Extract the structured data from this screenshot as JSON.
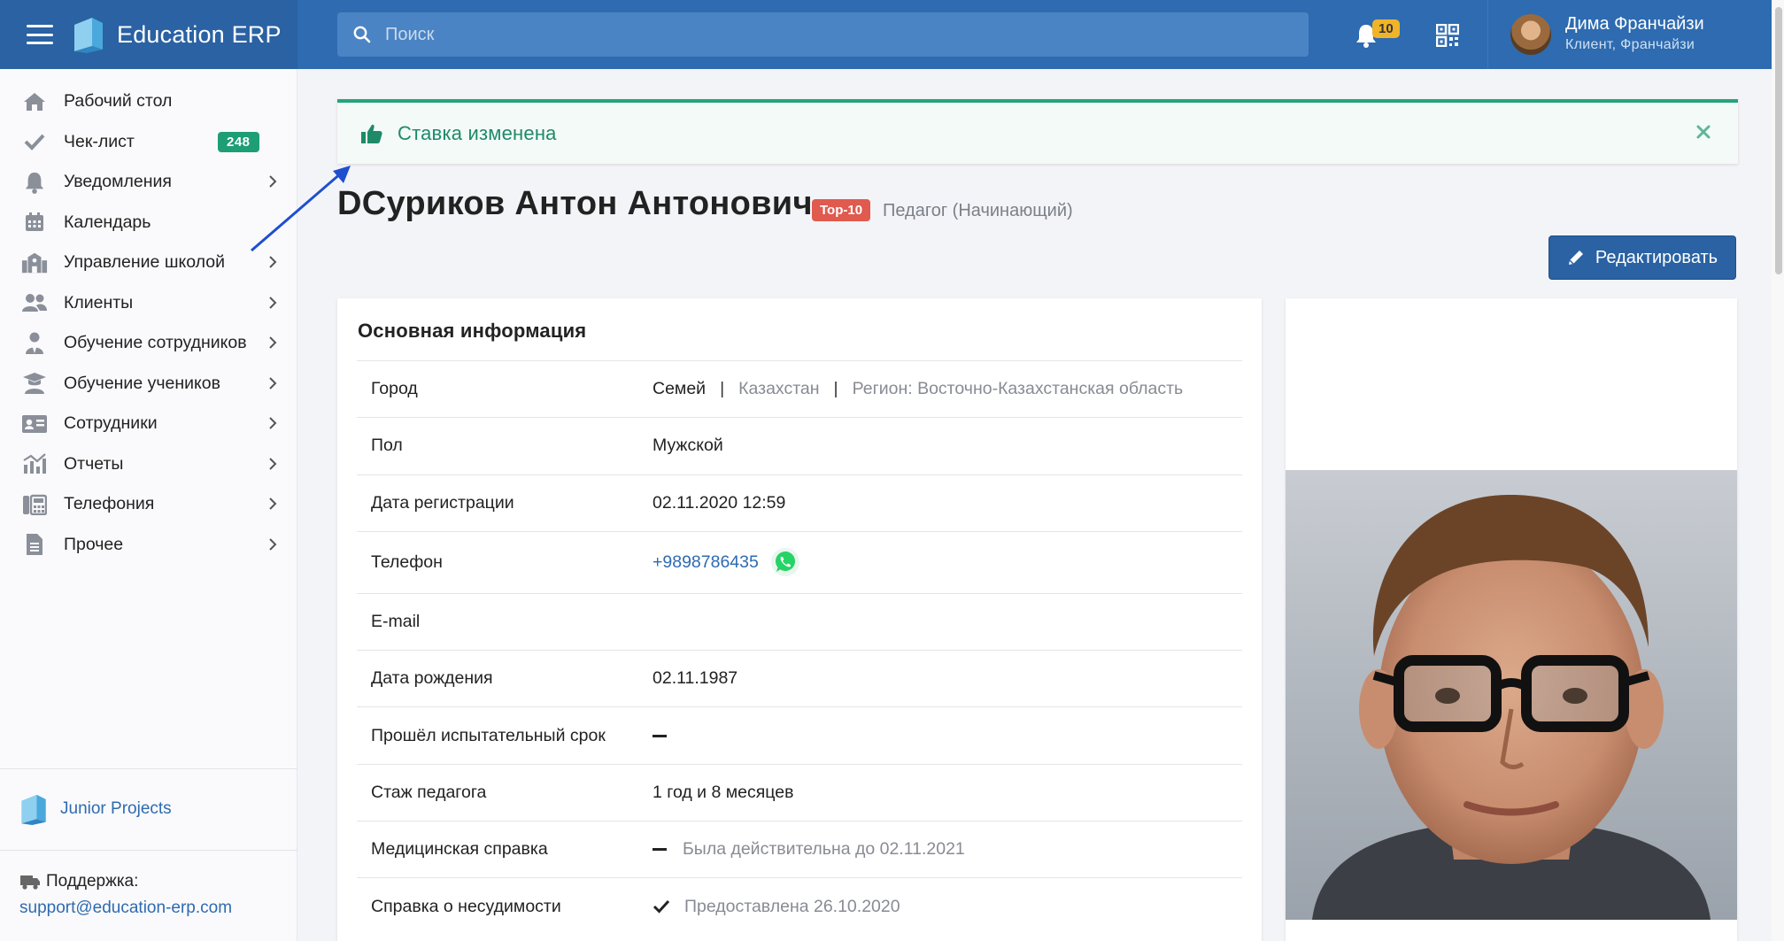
{
  "header": {
    "brand": "Education ERP",
    "search_placeholder": "Поиск",
    "notifications_count": "10",
    "user_name": "Дима Франчайзи",
    "user_role": "Клиент, Франчайзи"
  },
  "sidebar": {
    "items": [
      {
        "label": "Рабочий стол",
        "icon": "home-icon",
        "has_submenu": false
      },
      {
        "label": "Чек-лист",
        "icon": "check-icon",
        "has_submenu": false,
        "badge": "248"
      },
      {
        "label": "Уведомления",
        "icon": "bell-icon",
        "has_submenu": true
      },
      {
        "label": "Календарь",
        "icon": "calendar-icon",
        "has_submenu": false
      },
      {
        "label": "Управление школой",
        "icon": "school-icon",
        "has_submenu": true
      },
      {
        "label": "Клиенты",
        "icon": "users-icon",
        "has_submenu": true
      },
      {
        "label": "Обучение сотрудников",
        "icon": "user-tie-icon",
        "has_submenu": true
      },
      {
        "label": "Обучение учеников",
        "icon": "graduation-cap-icon",
        "has_submenu": true
      },
      {
        "label": "Сотрудники",
        "icon": "id-card-icon",
        "has_submenu": true
      },
      {
        "label": "Отчеты",
        "icon": "chart-icon",
        "has_submenu": true
      },
      {
        "label": "Телефония",
        "icon": "phone-office-icon",
        "has_submenu": true
      },
      {
        "label": "Прочее",
        "icon": "file-icon",
        "has_submenu": true
      }
    ],
    "company": "Junior Projects",
    "support_label": "Поддержка:",
    "support_email": "support@education-erp.com"
  },
  "alert": {
    "text": "Ставка изменена",
    "color": "#22a47a"
  },
  "profile": {
    "name": "DСуриков Антон Антонович",
    "tag": "Top-10",
    "position": "Педагог (Начинающий)",
    "edit_label": "Редактировать"
  },
  "info": {
    "title": "Основная информация",
    "city_label": "Город",
    "city": "Семей",
    "country": "Казахстан",
    "region": "Регион: Восточно-Казахстанская область",
    "sex_label": "Пол",
    "sex": "Мужской",
    "reg_label": "Дата регистрации",
    "reg_date": "02.11.2020 12:59",
    "phone_label": "Телефон",
    "phone": "+9898786435",
    "email_label": "E-mail",
    "birth_label": "Дата рождения",
    "birth": "02.11.1987",
    "probation_label": "Прошёл испытательный срок",
    "exp_label": "Стаж педагога",
    "exp": "1 год и 8 месяцев",
    "med_label": "Медицинская справка",
    "med": "Была действительна до 02.11.2021",
    "crim_label": "Справка о несудимости",
    "crim": "Предоставлена 26.10.2020"
  },
  "colors": {
    "primary": "#2e6bb0",
    "badge_green": "#1e9e74",
    "tag_red": "#e05a4e",
    "notify_yellow": "#f0b429"
  }
}
